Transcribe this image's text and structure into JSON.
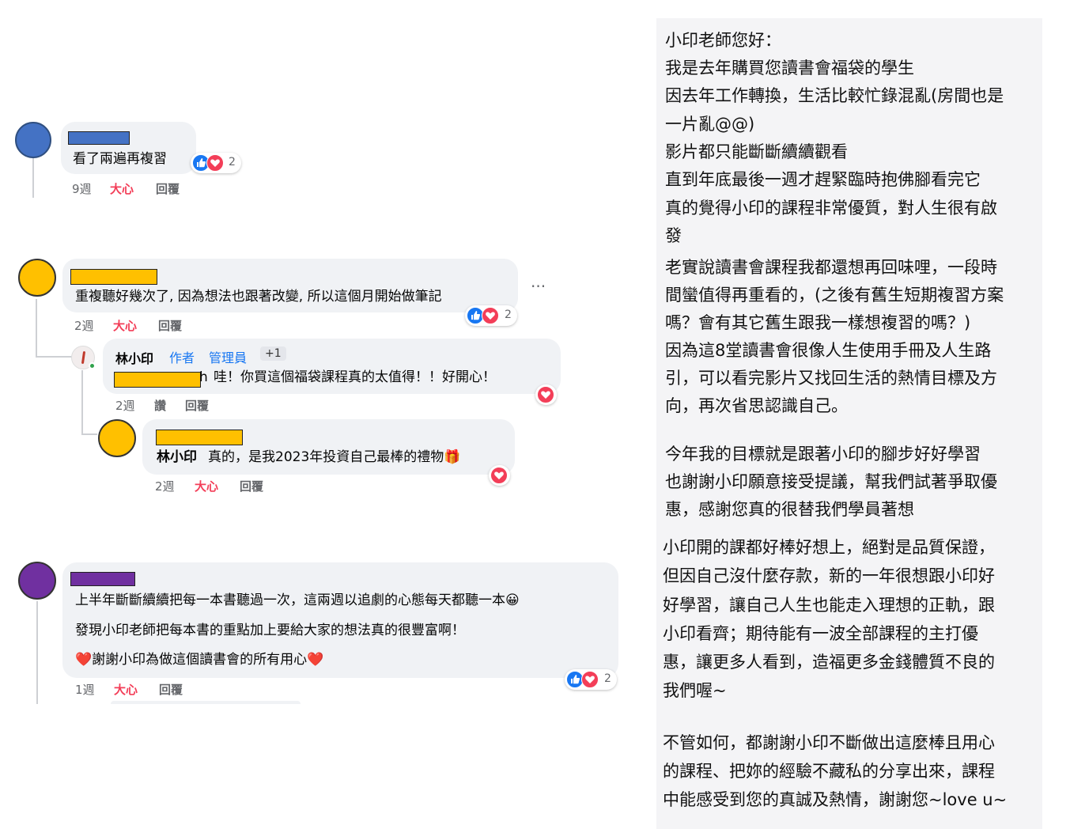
{
  "comments": [
    {
      "text": "看了兩遍再複習",
      "time": "9週",
      "love_label": "大心",
      "reply_label": "回覆",
      "reaction_count": "2",
      "avatar_color": "#4472c4",
      "redact_color": "#4472c4"
    },
    {
      "text": "重複聽好幾次了, 因為想法也跟著改變, 所以這個月開始做筆記",
      "time": "2週",
      "love_label": "大心",
      "reply_label": "回覆",
      "reaction_count": "2",
      "more_label": "···",
      "avatar_color": "#ffc000",
      "redact_color": "#ffc000"
    },
    {
      "lines": [
        "上半年斷斷續續把每一本書聽過一次，這兩週以追劇的心態每天都聽一本😀",
        "發現小印老師把每本書的重點加上要給大家的想法真的很豐富啊！",
        "❤️謝謝小印為做這個讀書會的所有用心❤️"
      ],
      "time": "1週",
      "love_label": "大心",
      "reply_label": "回覆",
      "reaction_count": "2",
      "avatar_color": "#7030a0",
      "redact_color": "#7030a0"
    }
  ],
  "replies": [
    {
      "author": "林小印",
      "badge_author": "作者",
      "badge_admin": "管理員",
      "badge_extra": "+1",
      "mention_tail": "h",
      "text": "哇！你買這個福袋課程真的太值得！！好開心！",
      "time": "2週",
      "like_label": "讚",
      "reply_label": "回覆",
      "redact_color": "#ffc000"
    },
    {
      "mention": "林小印",
      "text": "真的，是我2023年投資自己最棒的禮物🎁",
      "time": "2週",
      "love_label": "大心",
      "reply_label": "回覆",
      "avatar_color": "#ffc000",
      "redact_color": "#ffc000"
    }
  ],
  "letter": {
    "lines": [
      "小印老師您好：",
      "我是去年購買您讀書會福袋的學生",
      "因去年工作轉換，生活比較忙錄混亂(房間也是",
      "一片亂@@)",
      "影片都只能斷斷續續觀看",
      "直到年底最後一週才趕緊臨時抱佛腳看完它",
      "真的覺得小印的課程非常優質，對人生很有啟",
      "發",
      "老實說讀書會課程我都還想再回味哩，一段時",
      "間蠻值得再重看的，(之後有舊生短期複習方案",
      "嗎？會有其它舊生跟我一樣想複習的嗎？)",
      "因為這8堂讀書會很像人生使用手冊及人生路",
      "引，可以看完影片又找回生活的熱情目標及方",
      "向，再次省思認識自己。",
      "今年我的目標就是跟著小印的腳步好好學習",
      "也謝謝小印願意接受提議，幫我們試著爭取優",
      "惠，感謝您真的很替我們學員著想",
      "小印開的課都好棒好想上，絕對是品質保證，",
      "但因自己沒什麼存款，新的一年很想跟小印好",
      "好學習，讓自己人生也能走入理想的正軌，跟",
      "小印看齊；期待能有一波全部課程的主打優",
      "惠，讓更多人看到，造福更多金錢體質不良的",
      "我們喔~",
      "不管如何，都謝謝小印不斷做出這麼棒且用心",
      "的課程、把妳的經驗不藏私的分享出來，課程",
      "中能感受到您的真誠及熱情，謝謝您~love u~"
    ]
  }
}
